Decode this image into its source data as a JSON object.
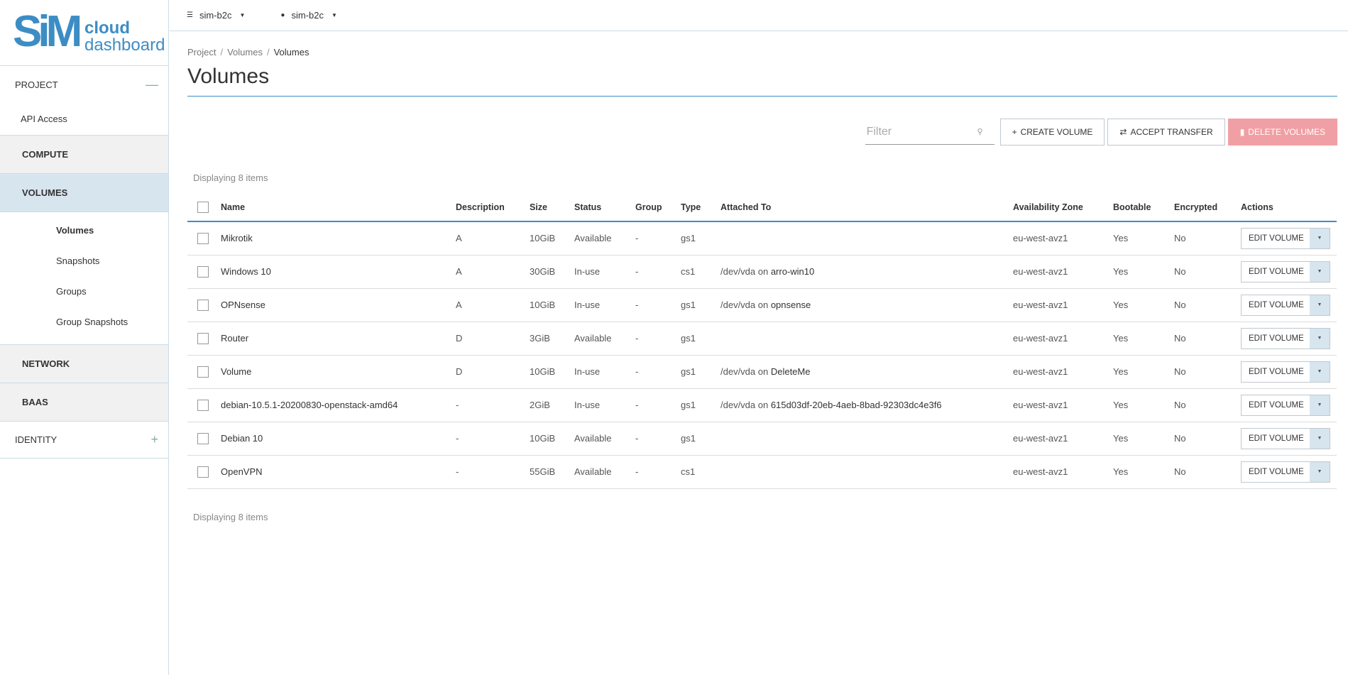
{
  "brand": {
    "mark": "SiM",
    "line1": "cloud",
    "line2": "dashboard",
    "accent": "#3d8dc4"
  },
  "sidebar": {
    "project_label": "PROJECT",
    "api_access": "API Access",
    "compute": "COMPUTE",
    "volumes": "VOLUMES",
    "volumes_items": [
      "Volumes",
      "Snapshots",
      "Groups",
      "Group Snapshots"
    ],
    "network": "NETWORK",
    "baas": "BAAS",
    "identity": "IDENTITY"
  },
  "topbar": {
    "domain": "sim-b2c",
    "user": "sim-b2c"
  },
  "breadcrumb": [
    "Project",
    "Volumes",
    "Volumes"
  ],
  "page_title": "Volumes",
  "toolbar": {
    "filter_placeholder": "Filter",
    "create": "CREATE VOLUME",
    "accept": "ACCEPT TRANSFER",
    "delete": "DELETE VOLUMES"
  },
  "count_text": "Displaying 8 items",
  "columns": [
    "Name",
    "Description",
    "Size",
    "Status",
    "Group",
    "Type",
    "Attached To",
    "Availability Zone",
    "Bootable",
    "Encrypted",
    "Actions"
  ],
  "action_label": "EDIT VOLUME",
  "rows": [
    {
      "name": "Mikrotik",
      "desc": "A",
      "size": "10GiB",
      "status": "Available",
      "group": "-",
      "type": "gs1",
      "att_pre": "",
      "att_link": "",
      "zone": "eu-west-avz1",
      "boot": "Yes",
      "enc": "No"
    },
    {
      "name": "Windows 10",
      "desc": "A",
      "size": "30GiB",
      "status": "In-use",
      "group": "-",
      "type": "cs1",
      "att_pre": "/dev/vda on ",
      "att_link": "arro-win10",
      "zone": "eu-west-avz1",
      "boot": "Yes",
      "enc": "No"
    },
    {
      "name": "OPNsense",
      "desc": "A",
      "size": "10GiB",
      "status": "In-use",
      "group": "-",
      "type": "gs1",
      "att_pre": "/dev/vda on ",
      "att_link": "opnsense",
      "zone": "eu-west-avz1",
      "boot": "Yes",
      "enc": "No"
    },
    {
      "name": "Router",
      "desc": "D",
      "size": "3GiB",
      "status": "Available",
      "group": "-",
      "type": "gs1",
      "att_pre": "",
      "att_link": "",
      "zone": "eu-west-avz1",
      "boot": "Yes",
      "enc": "No"
    },
    {
      "name": "Volume",
      "desc": "D",
      "size": "10GiB",
      "status": "In-use",
      "group": "-",
      "type": "gs1",
      "att_pre": "/dev/vda on ",
      "att_link": "DeleteMe",
      "zone": "eu-west-avz1",
      "boot": "Yes",
      "enc": "No"
    },
    {
      "name": "debian-10.5.1-20200830-openstack-amd64",
      "desc": "-",
      "size": "2GiB",
      "status": "In-use",
      "group": "-",
      "type": "gs1",
      "att_pre": "/dev/vda on ",
      "att_link": "615d03df-20eb-4aeb-8bad-92303dc4e3f6",
      "zone": "eu-west-avz1",
      "boot": "Yes",
      "enc": "No"
    },
    {
      "name": "Debian 10",
      "desc": "-",
      "size": "10GiB",
      "status": "Available",
      "group": "-",
      "type": "gs1",
      "att_pre": "",
      "att_link": "",
      "zone": "eu-west-avz1",
      "boot": "Yes",
      "enc": "No"
    },
    {
      "name": "OpenVPN",
      "desc": "-",
      "size": "55GiB",
      "status": "Available",
      "group": "-",
      "type": "cs1",
      "att_pre": "",
      "att_link": "",
      "zone": "eu-west-avz1",
      "boot": "Yes",
      "enc": "No"
    }
  ]
}
